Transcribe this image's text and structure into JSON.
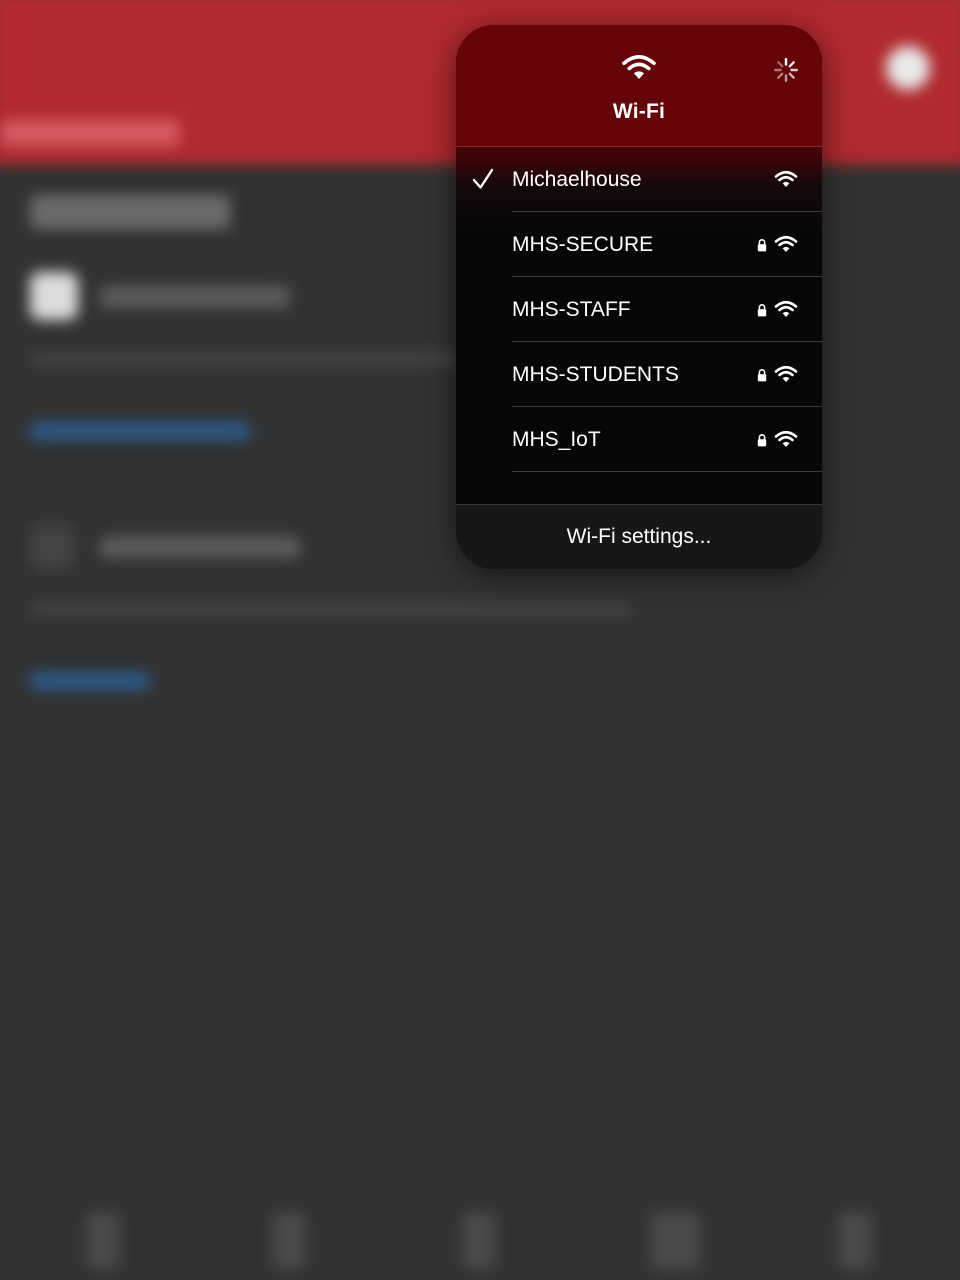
{
  "wifi_menu": {
    "title": "Wi-Fi",
    "networks": [
      {
        "name": "Michaelhouse",
        "connected": true,
        "secured": false
      },
      {
        "name": "MHS-SECURE",
        "connected": false,
        "secured": true
      },
      {
        "name": "MHS-STAFF",
        "connected": false,
        "secured": true
      },
      {
        "name": "MHS-STUDENTS",
        "connected": false,
        "secured": true
      },
      {
        "name": "MHS_IoT",
        "connected": false,
        "secured": true
      }
    ],
    "settings_label": "Wi-Fi settings..."
  },
  "icons": {
    "header": "wifi-icon",
    "scanning": "loading-spinner-icon",
    "connected": "checkmark-icon",
    "secured": "lock-icon",
    "signal": "wifi-signal-icon"
  },
  "colors": {
    "header_accent": "#650509",
    "app_header": "#b02a30",
    "panel_background": "#070708",
    "text": "#ffffff"
  }
}
